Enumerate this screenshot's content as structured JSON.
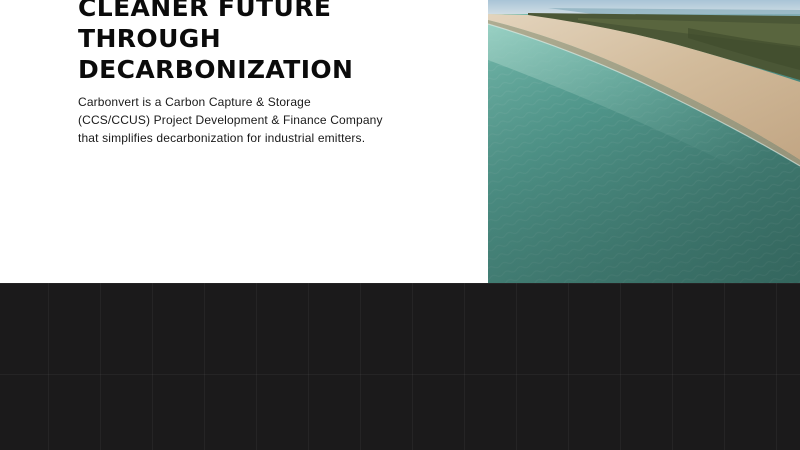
{
  "hero": {
    "headline_lines": [
      "CLEANER FUTURE",
      "THROUGH",
      "DECARBONIZATION"
    ],
    "description": "Carbonvert is a Carbon Capture & Storage (CCS/CCUS) Project Development & Finance Company that simplifies decarbonization for industrial emitters."
  },
  "colors": {
    "background": "#ffffff",
    "headline": "#0b0b0b",
    "body_text": "#1a1a1a",
    "dark_band": "#1b1a1b",
    "sea": "#4f9a90",
    "sand": "#cdb79a",
    "vegetation": "#4b5736",
    "sky": "#b9cfdc"
  },
  "image": {
    "subject": "aerial-beach-coastline-photo"
  }
}
